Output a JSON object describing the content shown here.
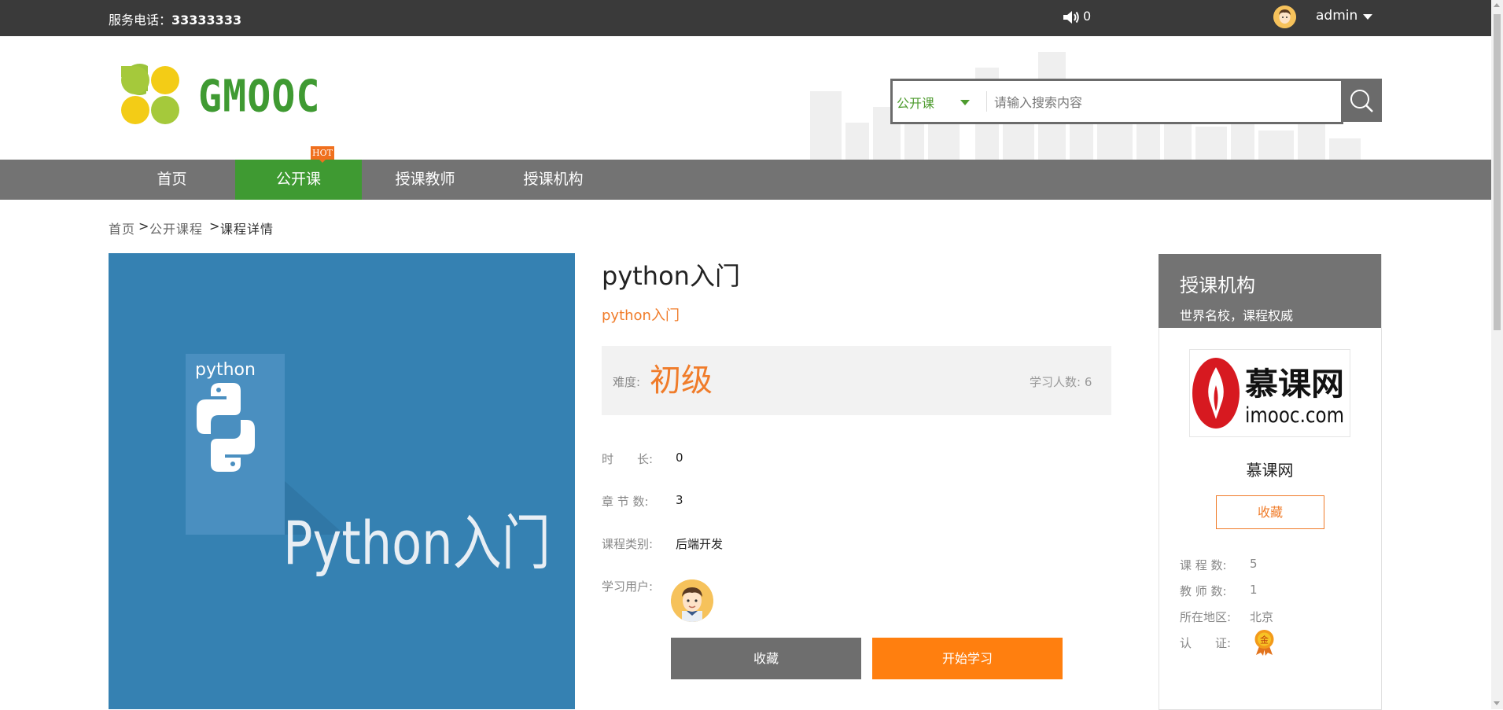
{
  "topbar": {
    "phone_label": "服务电话：",
    "phone_number": "33333333",
    "message_count": "0",
    "username": "admin"
  },
  "header": {
    "logo_text": "GMOOC",
    "search": {
      "category": "公开课",
      "placeholder": "请输入搜索内容"
    }
  },
  "nav": {
    "items": [
      {
        "label": "首页"
      },
      {
        "label": "公开课",
        "active": true,
        "badge": "HOT"
      },
      {
        "label": "授课教师"
      },
      {
        "label": "授课机构"
      }
    ]
  },
  "breadcrumb": [
    "首页",
    "公开课程",
    "课程详情"
  ],
  "course": {
    "image_text": "Python入门",
    "image_icon_label": "python",
    "title": "python入门",
    "subtitle": "python入门",
    "difficulty_label": "难度:",
    "difficulty": "初级",
    "learners_label": "学习人数:",
    "learners": "6",
    "fields": [
      {
        "label": "时　　长:",
        "value": "0"
      },
      {
        "label": "章 节 数:",
        "value": "3"
      },
      {
        "label": "课程类别:",
        "value": "后端开发"
      }
    ],
    "users_label": "学习用户:",
    "fav_button": "收藏",
    "start_button": "开始学习"
  },
  "org": {
    "header_title": "授课机构",
    "header_subtitle": "世界名校，课程权威",
    "logo_text_cn": "慕课网",
    "logo_text_en": "imooc.com",
    "name": "慕课网",
    "fav_button": "收藏",
    "stats": [
      {
        "label": "课 程 数:",
        "value": "5"
      },
      {
        "label": "教 师 数:",
        "value": "1"
      },
      {
        "label": "所在地区:",
        "value": "北京"
      },
      {
        "label": "认　　证:",
        "value": ""
      }
    ],
    "cert_badge": "金"
  },
  "colors": {
    "brand_green": "#3f9a32",
    "accent_orange": "#ff7f0f",
    "topbar": "#3a3a3a",
    "nav": "#737373"
  }
}
